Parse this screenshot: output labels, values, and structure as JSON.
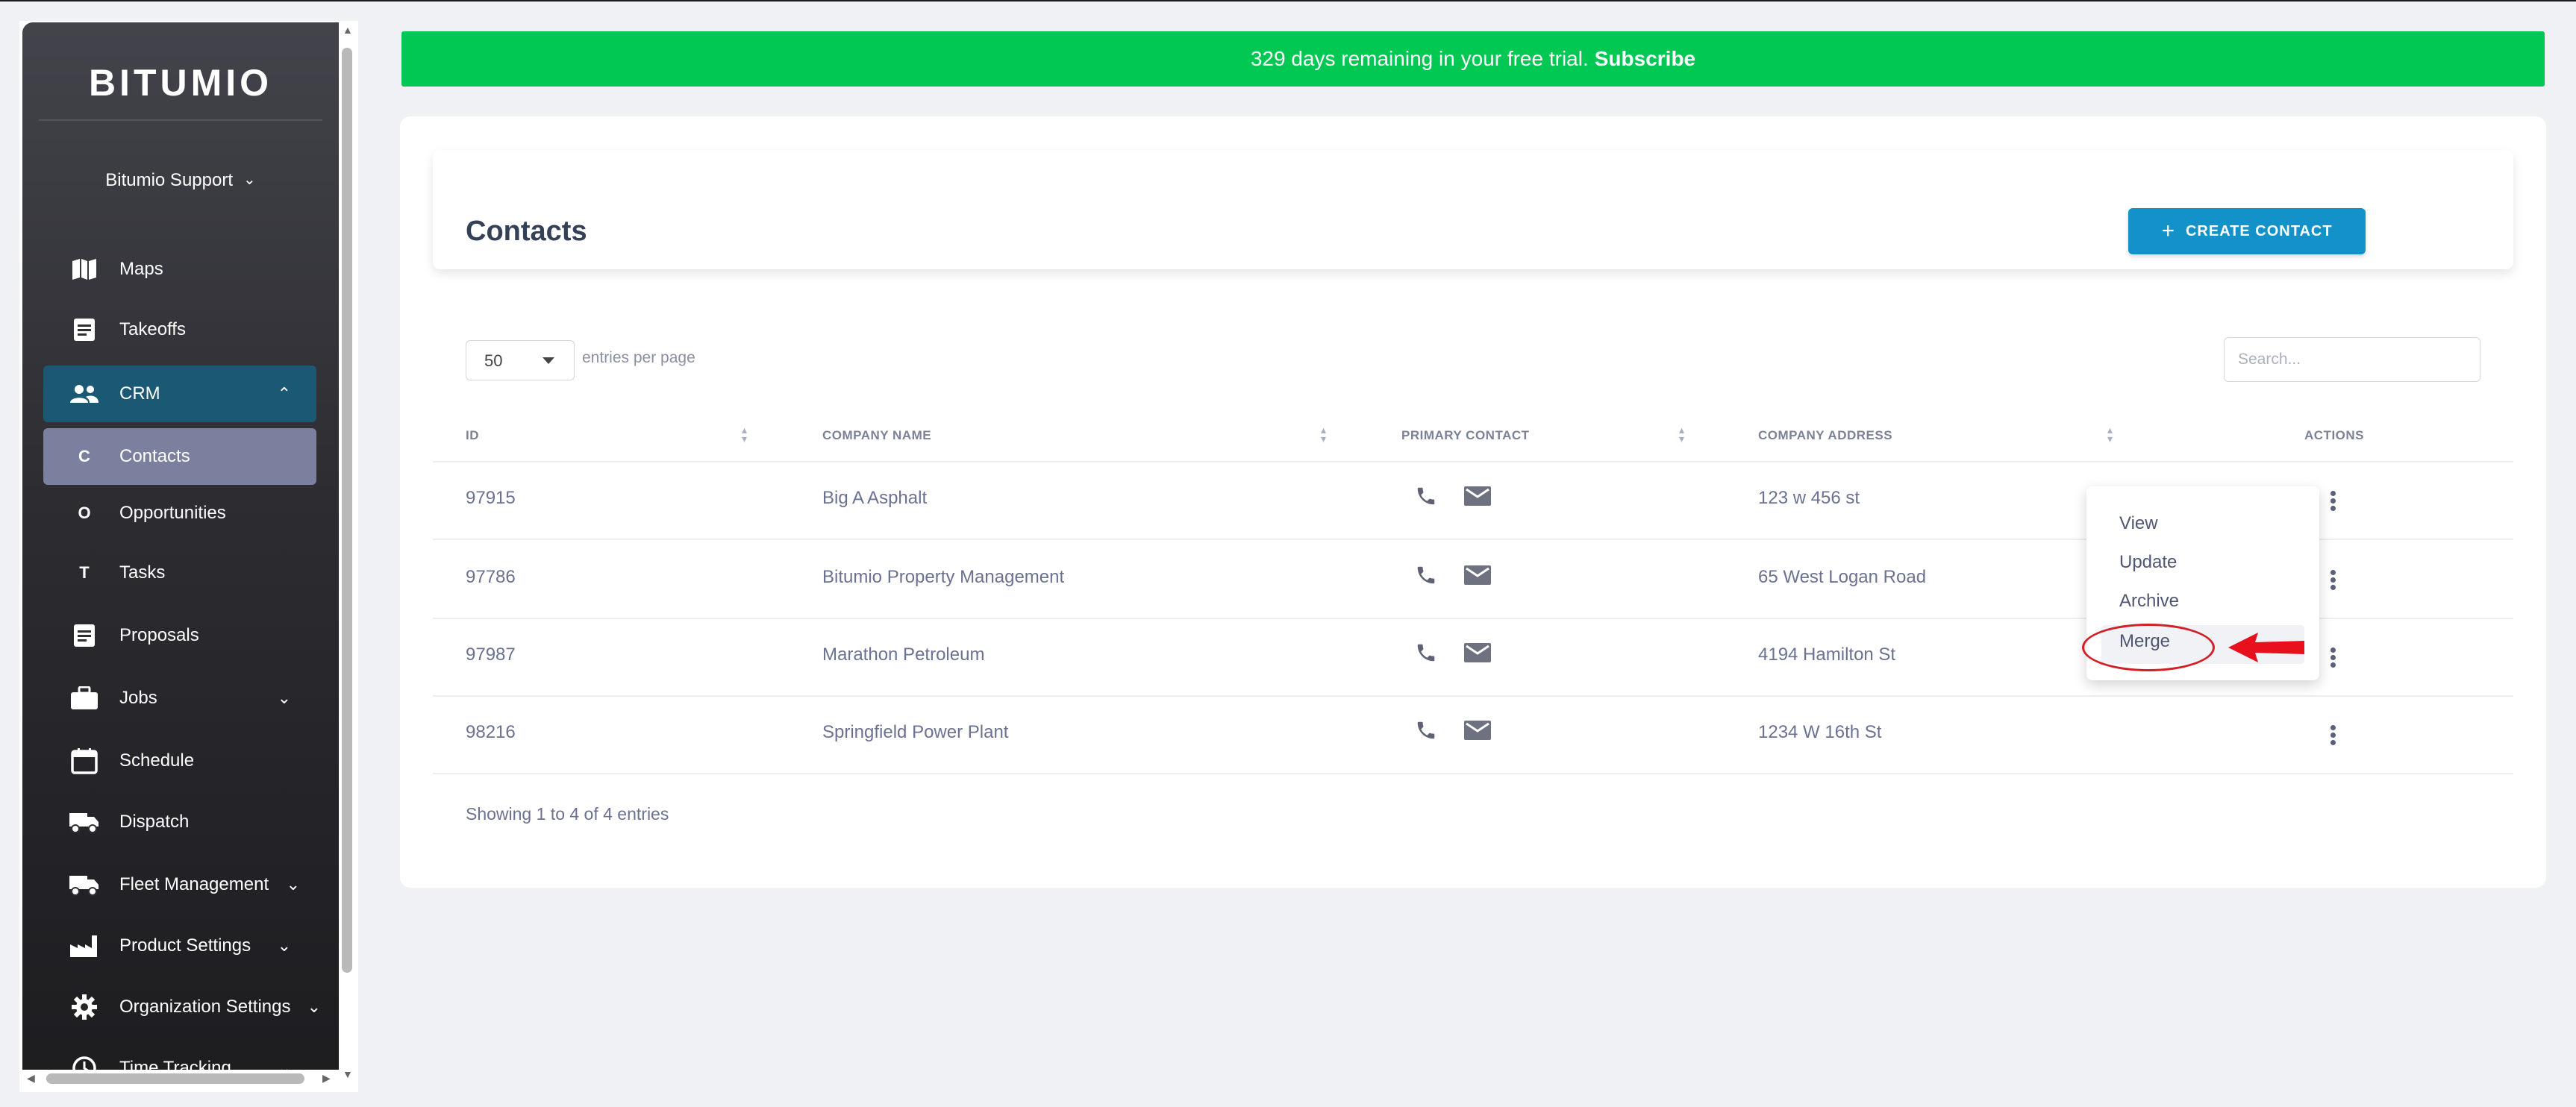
{
  "app": {
    "logo": "BITUMIO"
  },
  "sidebar": {
    "org_name": "Bitumio Support",
    "items": [
      {
        "label": "Maps",
        "icon": "map-icon"
      },
      {
        "label": "Takeoffs",
        "icon": "document-icon"
      },
      {
        "label": "CRM",
        "icon": "people-icon",
        "expanded": true
      },
      {
        "label": "Contacts",
        "letter": "C",
        "active": true
      },
      {
        "label": "Opportunities",
        "letter": "O"
      },
      {
        "label": "Tasks",
        "letter": "T"
      },
      {
        "label": "Proposals",
        "icon": "document-icon"
      },
      {
        "label": "Jobs",
        "icon": "briefcase-icon"
      },
      {
        "label": "Schedule",
        "icon": "calendar-icon"
      },
      {
        "label": "Dispatch",
        "icon": "truck-icon"
      },
      {
        "label": "Fleet Management",
        "icon": "truck-icon"
      },
      {
        "label": "Product Settings",
        "icon": "factory-icon"
      },
      {
        "label": "Organization Settings",
        "icon": "gear-icon"
      },
      {
        "label": "Time Tracking",
        "icon": "clock-icon"
      }
    ]
  },
  "banner": {
    "text": "329 days remaining in your free trial.",
    "link": "Subscribe",
    "color": "#00c853"
  },
  "page": {
    "title": "Contacts",
    "create_label": "CREATE CONTACT"
  },
  "table_controls": {
    "entries_value": "50",
    "entries_label": "entries per page",
    "search_placeholder": "Search..."
  },
  "table": {
    "columns": [
      "ID",
      "COMPANY NAME",
      "PRIMARY CONTACT",
      "COMPANY ADDRESS",
      "ACTIONS"
    ],
    "rows": [
      {
        "id": "97915",
        "company": "Big A Asphalt",
        "address": "123 w 456 st"
      },
      {
        "id": "97786",
        "company": "Bitumio Property Management",
        "address": "65 West Logan Road"
      },
      {
        "id": "97987",
        "company": "Marathon Petroleum",
        "address": "4194 Hamilton St"
      },
      {
        "id": "98216",
        "company": "Springfield Power Plant",
        "address": "1234 W 16th St"
      }
    ],
    "footer": "Showing 1 to 4 of 4 entries"
  },
  "actions_menu": {
    "items": [
      "View",
      "Update",
      "Archive",
      "Merge"
    ],
    "highlighted": "Merge"
  },
  "colors": {
    "accent": "#1391c9",
    "sidebar_active": "#1b5873",
    "annotation": "#d32027"
  }
}
